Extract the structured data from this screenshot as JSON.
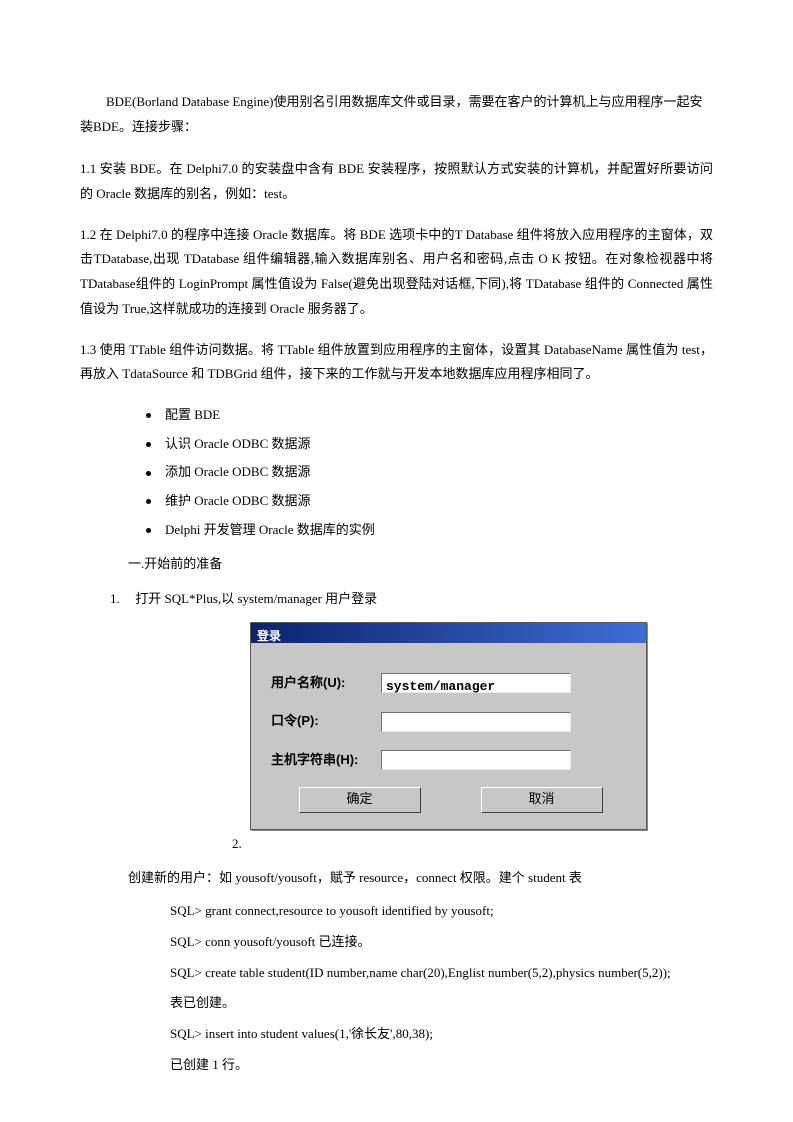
{
  "intro": "BDE(Borland Database Engine)使用别名引用数据库文件或目录，需要在客户的计算机上与应用程序一起安装BDE。连接步骤：",
  "sec11": "1.1  安装 BDE。在 Delphi7.0 的安装盘中含有 BDE 安装程序，按照默认方式安装的计算机，并配置好所要访问的 Oracle 数据库的别名，例如：test。",
  "sec12": "1.2  在 Delphi7.0 的程序中连接 Oracle 数据库。将 BDE 选项卡中的T Database 组件将放入应用程序的主窗体，双击TDatabase,出现 TDatabase 组件编辑器,输入数据库别名、用户名和密码,点击 O K 按钮。在对象检视器中将 TDatabase组件的 LoginPrompt 属性值设为 False(避免出现登陆对话框,下同),将 TDatabase 组件的 Connected 属性值设为 True,这样就成功的连接到 Oracle 服务器了。",
  "sec13": "1.3 使用 TTable 组件访问数据。将 TTable 组件放置到应用程序的主窗体，设置其 DatabaseName 属性值为 test，再放入 TdataSource 和 TDBGrid 组件，接下来的工作就与开发本地数据库应用程序相同了。",
  "bullets": [
    "配置 BDE",
    "认识 Oracle ODBC 数据源",
    "添加 Oracle ODBC 数据源",
    "维护 Oracle ODBC 数据源",
    "Delphi 开发管理 Oracle 数据库的实例"
  ],
  "prep_heading": "一.开始前的准备",
  "ol1_num": "1.",
  "ol1_text": "打开 SQL*Plus,以 system/manager 用户登录",
  "dialog": {
    "title": "登录",
    "lbl_user": "用户名称(U):",
    "val_user": "system/manager",
    "lbl_pass": "口令(P):",
    "val_pass": "",
    "lbl_host": "主机字符串(H):",
    "val_host": "",
    "ok": "确定",
    "cancel": "取消"
  },
  "ol2_num": "2.",
  "create_user": "创建新的用户：如 yousoft/yousoft，赋予 resource，connect 权限。建个 student 表",
  "sql": [
    "SQL> grant connect,resource to yousoft identified by yousoft;",
    "SQL> conn yousoft/yousoft 已连接。",
    "SQL> create table student(ID number,name char(20),Englist number(5,2),physics number(5,2));",
    "表已创建。",
    "SQL> insert into student values(1,'徐长友',80,38);",
    "已创建  1  行。"
  ]
}
